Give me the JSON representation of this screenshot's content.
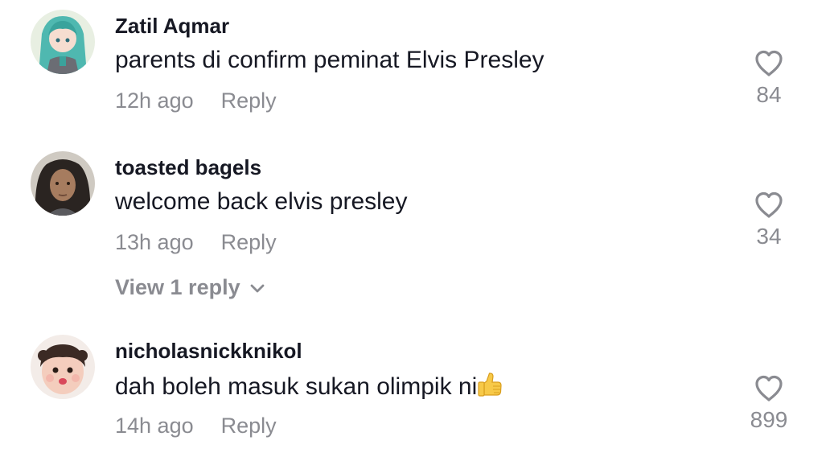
{
  "comments": [
    {
      "username": "Zatil Aqmar",
      "text": "parents di confirm peminat Elvis Presley",
      "time": "12h ago",
      "reply_label": "Reply",
      "likes": "84"
    },
    {
      "username": "toasted bagels",
      "text": "welcome back elvis presley",
      "time": "13h ago",
      "reply_label": "Reply",
      "likes": "34",
      "view_replies": "View 1 reply"
    },
    {
      "username": "nicholasnickknikol",
      "text": "dah boleh masuk sukan olimpik ni",
      "time": "14h ago",
      "reply_label": "Reply",
      "likes": "899"
    }
  ],
  "colors": {
    "text": "#161823",
    "secondary": "#8a8b91",
    "background": "#ffffff"
  },
  "icons": {
    "like": "heart-outline-icon",
    "expand": "chevron-down-icon",
    "emoji": "thumbs-up-emoji"
  }
}
